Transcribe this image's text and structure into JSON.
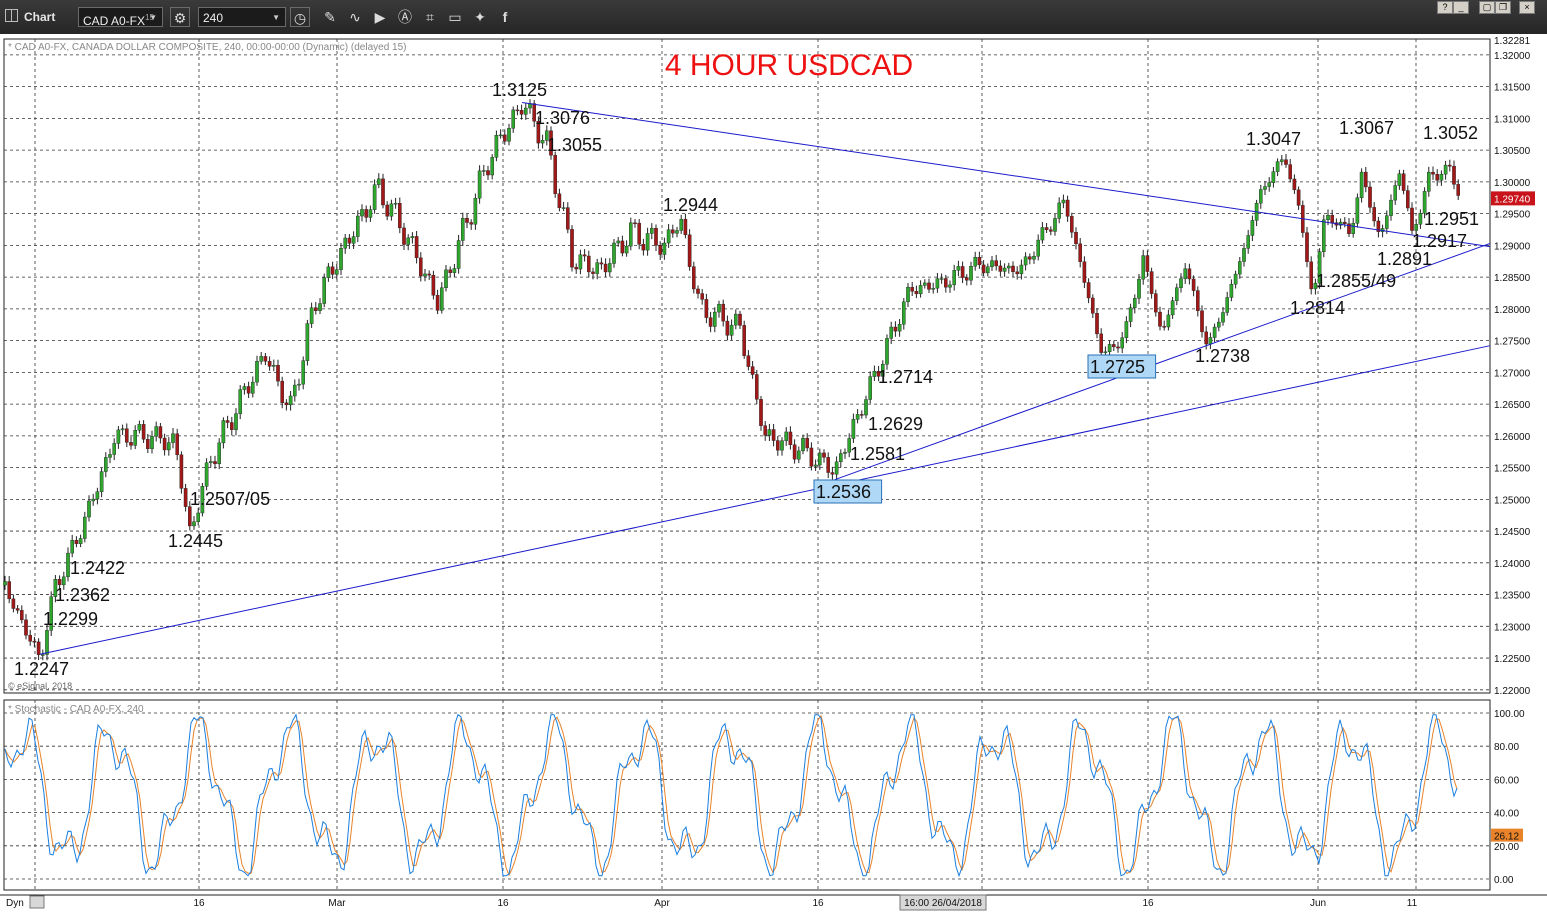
{
  "window": {
    "title": "Chart",
    "symbol": "CAD A0-FX",
    "symbol_sup": "15",
    "interval": "240",
    "buttons": [
      "help-icon",
      "minimize-icon",
      "restore-icon",
      "close-icon"
    ]
  },
  "toolbar_icons": [
    "settings-icon",
    "clock-icon",
    "pencil-icon",
    "wave-icon",
    "play-icon",
    "alert-icon",
    "tag-icon",
    "chat-icon",
    "twitter-icon",
    "facebook-icon"
  ],
  "colors": {
    "up_candle": "#2ea62e",
    "down_candle": "#a01818",
    "trendline": "#1a1acc",
    "stoch_k": "#1a7fe0",
    "stoch_d": "#e8832a",
    "title": "#ee1111",
    "label_box": "#aed8f5"
  },
  "chart_data": [
    {
      "type": "candlestick",
      "title": "4 HOUR USDCAD",
      "subtitle": "* CAD A0-FX, CANADA DOLLAR COMPOSITE, 240, 00:00-00:00 (Dynamic) (delayed 15)",
      "watermark": "© eSignal, 2018",
      "ylim": [
        1.2195,
        1.3225
      ],
      "y_ticks": [
        "1.32000",
        "1.31500",
        "1.31000",
        "1.30500",
        "1.30000",
        "1.29500",
        "1.29000",
        "1.28500",
        "1.28000",
        "1.27500",
        "1.27000",
        "1.26500",
        "1.26000",
        "1.25500",
        "1.25000",
        "1.24500",
        "1.24000",
        "1.23500",
        "1.23000",
        "1.22500",
        "1.22000"
      ],
      "y_top_label": "1.32281",
      "last_price": "1.29740",
      "x_labels": [
        "16",
        "Mar",
        "16",
        "Apr",
        "16",
        "16",
        "Jun",
        "11"
      ],
      "cursor_time": "16:00 26/04/2018",
      "key_prices": [
        1.2247,
        1.2299,
        1.2362,
        1.2422,
        1.2445,
        1.2507,
        1.3125,
        1.3076,
        1.3055,
        1.2944,
        1.2536,
        1.2581,
        1.2629,
        1.2714,
        1.2725,
        1.2738,
        1.3047,
        1.2814,
        1.2855,
        1.3067,
        1.2891,
        1.3052,
        1.2917,
        1.2951
      ],
      "annotations": [
        "1.2247",
        "1.2299",
        "1.2362",
        "1.2422",
        "1.2445",
        "1.2507/05",
        "1.3125",
        "1.3076",
        "1.3055",
        "1.2944",
        "1.2536",
        "1.2581",
        "1.2629",
        "1.2714",
        "1.2725",
        "1.2738",
        "1.3047",
        "1.2814",
        "1.2855/49",
        "1.3067",
        "1.2891",
        "1.3052",
        "1.2917",
        "1.2951"
      ]
    },
    {
      "type": "line",
      "title": "* Stochastic - CAD A0-FX, 240",
      "ylim": [
        0,
        100
      ],
      "y_ticks": [
        "100.00",
        "80.00",
        "60.00",
        "40.00",
        "20.00",
        "0.00"
      ],
      "last_value": "26.12",
      "series_colors": [
        "#1a7fe0",
        "#e8832a"
      ]
    }
  ],
  "footer": {
    "dyn": "Dyn"
  }
}
